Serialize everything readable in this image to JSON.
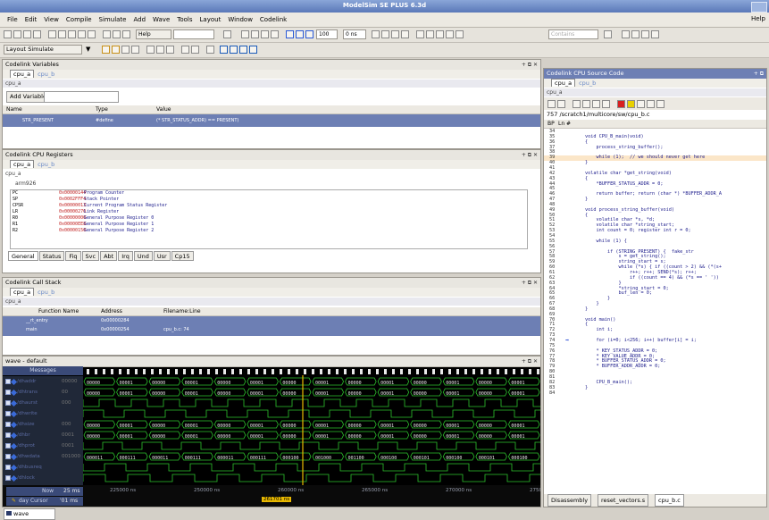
{
  "window": {
    "title": "ModelSim SE PLUS 6.3d"
  },
  "menu": [
    "File",
    "Edit",
    "View",
    "Compile",
    "Simulate",
    "Add",
    "Wave",
    "Tools",
    "Layout",
    "Window",
    "Codelink"
  ],
  "menu_help": "Help",
  "toolbar": {
    "help_label": "Help",
    "step_field": "100",
    "zero_field": "0 ns",
    "layout_label": "Layout",
    "layout_value": "Simulate",
    "contains_placeholder": "Contains"
  },
  "codelink_variables": {
    "title": "Codelink Variables",
    "tabs": [
      "cpu_a",
      "cpu_b"
    ],
    "context": "cpu_a",
    "add_label": "Add Variable",
    "columns": [
      "Name",
      "Type",
      "Value"
    ],
    "rows": [
      {
        "name": "STR_PRESENT",
        "type": "#define",
        "value": "(* STR_STATUS_ADDR) == PRESENT)"
      }
    ]
  },
  "cpu_registers": {
    "title": "Codelink CPU Registers",
    "tabs": [
      "cpu_a",
      "cpu_b"
    ],
    "context": "cpu_a",
    "cpu_type": "arm926",
    "registers": [
      {
        "name": "PC",
        "value": "0x00000144",
        "desc": "Program Counter"
      },
      {
        "name": "SP",
        "value": "0x0002FFF4",
        "desc": "Stack Pointer"
      },
      {
        "name": "CPSR",
        "value": "0x00000013",
        "desc": "Current Program Status Register"
      },
      {
        "name": "LR",
        "value": "0x00000270",
        "desc": "Link Register"
      },
      {
        "name": "R0",
        "value": "0x00000000",
        "desc": "General Purpose Register 0"
      },
      {
        "name": "R1",
        "value": "0x00000EE8",
        "desc": "General Purpose Register 1"
      },
      {
        "name": "R2",
        "value": "0x00000150",
        "desc": "General Purpose Register 2"
      }
    ],
    "mode_tabs": [
      "General",
      "Status",
      "Fiq",
      "Svc",
      "Abt",
      "Irq",
      "Und",
      "Usr",
      "Cp15"
    ]
  },
  "call_stack": {
    "title": "Codelink Call Stack",
    "tabs": [
      "cpu_a",
      "cpu_b"
    ],
    "context": "cpu_a",
    "columns": [
      "Function Name",
      "Address",
      "Filename:Line"
    ],
    "rows": [
      {
        "fn": "__rt_entry",
        "addr": "0x00000284",
        "file": ""
      },
      {
        "fn": "main",
        "addr": "0x00000254",
        "file": "cpu_b.c: 74"
      }
    ]
  },
  "wave": {
    "title": "wave - default",
    "messages_label": "Messages",
    "signals": [
      {
        "name": "/dhaddr",
        "value": "00000"
      },
      {
        "name": "/dhtrans",
        "value": "00"
      },
      {
        "name": "/dhaurst",
        "value": "000"
      },
      {
        "name": "/dhwrite",
        "value": ""
      },
      {
        "name": "/dhsize",
        "value": "000"
      },
      {
        "name": "/dhbr",
        "value": "0001"
      },
      {
        "name": "/dhprot",
        "value": "0001"
      },
      {
        "name": "/dhwdata",
        "value": "001000"
      },
      {
        "name": "/dhbusreq",
        "value": ""
      },
      {
        "name": "/dhlock",
        "value": ""
      }
    ],
    "bus_values": [
      "00000",
      "00001",
      "00000",
      "00001",
      "00000",
      "00001",
      "00000",
      "00001",
      "00000",
      "00001",
      "00000",
      "00001",
      "00000",
      "00001"
    ],
    "wdata_values": [
      "000011",
      "000111",
      "000011",
      "000111",
      "000011",
      "000111",
      "000100",
      "001000",
      "001100",
      "000100",
      "000101",
      "000100",
      "000101",
      "000100"
    ],
    "now_label": "Now",
    "now_value": "25 ms",
    "cursor_label": "day Cursor",
    "cursor_value": "'01 ms",
    "time_ticks": [
      "225000 ns",
      "250000 ns",
      "260000 ns",
      "265000 ns",
      "270000 ns",
      "275000 ns"
    ],
    "cursor_time": "261701 ns",
    "tab_label": "wave"
  },
  "source": {
    "title": "Codelink CPU Source Code",
    "tabs": [
      "cpu_a",
      "cpu_b"
    ],
    "context": "cpu_a",
    "path": "757  /scratch1/multicore/sw/cpu_b.c",
    "col_bp": "BP",
    "col_ln": "Ln #",
    "lines": [
      {
        "n": "34",
        "t": ""
      },
      {
        "n": "35",
        "t": "void CPU_B_main(void)"
      },
      {
        "n": "36",
        "t": "{"
      },
      {
        "n": "37",
        "t": "    process_string_buffer();"
      },
      {
        "n": "38",
        "t": ""
      },
      {
        "n": "39",
        "t": "    while (1);  // we should never get here",
        "hl": true
      },
      {
        "n": "40",
        "t": "}"
      },
      {
        "n": "41",
        "t": ""
      },
      {
        "n": "42",
        "t": "volatile char *get_string(void)"
      },
      {
        "n": "43",
        "t": "{"
      },
      {
        "n": "44",
        "t": "    *BUFFER_STATUS_ADDR = 0;"
      },
      {
        "n": "45",
        "t": ""
      },
      {
        "n": "46",
        "t": "    return buffer; return (char *) *BUFFER_ADDR_A"
      },
      {
        "n": "47",
        "t": "}"
      },
      {
        "n": "48",
        "t": ""
      },
      {
        "n": "49",
        "t": "void process_string_buffer(void)"
      },
      {
        "n": "50",
        "t": "{"
      },
      {
        "n": "51",
        "t": "    volatile char *s, *d;"
      },
      {
        "n": "52",
        "t": "    volatile char *string_start;"
      },
      {
        "n": "53",
        "t": "    int count = 0; register int r = 0;"
      },
      {
        "n": "54",
        "t": ""
      },
      {
        "n": "55",
        "t": "    while (1) {"
      },
      {
        "n": "56",
        "t": ""
      },
      {
        "n": "57",
        "t": "        if (STRING_PRESENT) {  fake_str"
      },
      {
        "n": "58",
        "t": "            s = get_string();"
      },
      {
        "n": "59",
        "t": "            string_start = s;"
      },
      {
        "n": "60",
        "t": "            while (*s) { if ((count > 2) && (*(s+"
      },
      {
        "n": "61",
        "t": "                r++; r++; SEND(*s); r++;"
      },
      {
        "n": "62",
        "t": "                if ((count == 4) && (*s == ' '))"
      },
      {
        "n": "63",
        "t": "            }"
      },
      {
        "n": "64",
        "t": "            *string_start = 0;"
      },
      {
        "n": "65",
        "t": "            buf_len = 0;"
      },
      {
        "n": "66",
        "t": "        }"
      },
      {
        "n": "67",
        "t": "    }"
      },
      {
        "n": "68",
        "t": "}"
      },
      {
        "n": "69",
        "t": ""
      },
      {
        "n": "70",
        "t": "void main()"
      },
      {
        "n": "71",
        "t": "{"
      },
      {
        "n": "72",
        "t": "    int i;"
      },
      {
        "n": "73",
        "t": ""
      },
      {
        "n": "74",
        "t": "    for (i=0; i<256; i++) buffer[i] = i;",
        "arrow": true
      },
      {
        "n": "75",
        "t": ""
      },
      {
        "n": "76",
        "t": "    * KEY_STATUS_ADDR = 0;"
      },
      {
        "n": "77",
        "t": "    * KEY_VALUE_ADDR = 0;"
      },
      {
        "n": "78",
        "t": "    * BUFFER_STATUS_ADDR = 0;"
      },
      {
        "n": "79",
        "t": "    * BUFFER_ADDR_ADDR = 0;"
      },
      {
        "n": "80",
        "t": ""
      },
      {
        "n": "81",
        "t": ""
      },
      {
        "n": "82",
        "t": "    CPU_B_main();"
      },
      {
        "n": "83",
        "t": "}"
      },
      {
        "n": "84",
        "t": ""
      }
    ],
    "bottom_tabs": [
      "Disassembly",
      "reset_vectors.s",
      "cpu_b.c"
    ]
  },
  "colors": {
    "selection": "#6d7fb4",
    "wave_bg": "#000000",
    "wave_signal": "#2ec42e",
    "cursor": "#e8b800"
  }
}
